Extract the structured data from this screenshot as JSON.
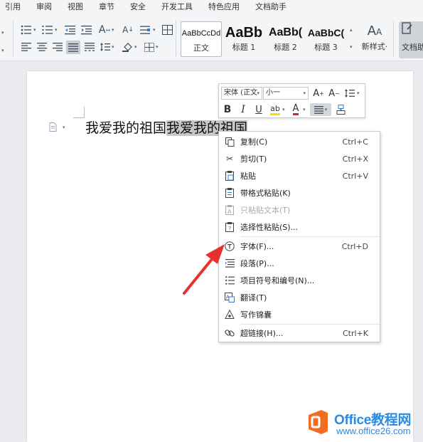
{
  "menubar": {
    "tabs": [
      "引用",
      "审阅",
      "视图",
      "章节",
      "安全",
      "开发工具",
      "特色应用",
      "文档助手"
    ]
  },
  "ribbon": {
    "styles": [
      {
        "sample": "AaBbCcDd",
        "name": "正文"
      },
      {
        "sample": "AaBb",
        "name": "标题 1"
      },
      {
        "sample": "AaBb(",
        "name": "标题 2"
      },
      {
        "sample": "AaBbC(",
        "name": "标题 3"
      }
    ],
    "new_style_label": "新样式·",
    "doc_helper_label": "文档助"
  },
  "document": {
    "text_plain": "我爱我的祖国",
    "text_selected": "我爱我的祖国"
  },
  "mini_toolbar": {
    "font_name": "宋体 (正文",
    "font_size": "小一"
  },
  "context_menu": {
    "items": [
      {
        "label": "复制(C)",
        "shortcut": "Ctrl+C",
        "icon": "copy-icon"
      },
      {
        "label": "剪切(T)",
        "shortcut": "Ctrl+X",
        "icon": "cut-icon"
      },
      {
        "label": "粘贴",
        "shortcut": "Ctrl+V",
        "icon": "paste-icon"
      },
      {
        "label": "带格式粘贴(K)",
        "shortcut": "",
        "icon": "paste-format-icon"
      },
      {
        "label": "只粘贴文本(T)",
        "shortcut": "",
        "icon": "paste-text-icon",
        "disabled": true
      },
      {
        "label": "选择性粘贴(S)...",
        "shortcut": "",
        "icon": "paste-special-icon"
      },
      {
        "label": "字体(F)...",
        "shortcut": "Ctrl+D",
        "icon": "font-icon"
      },
      {
        "label": "段落(P)...",
        "shortcut": "",
        "icon": "paragraph-icon"
      },
      {
        "label": "项目符号和编号(N)...",
        "shortcut": "",
        "icon": "bullets-icon"
      },
      {
        "label": "翻译(T)",
        "shortcut": "",
        "icon": "translate-icon"
      },
      {
        "label": "写作锦囊",
        "shortcut": "",
        "icon": "writing-icon"
      },
      {
        "label": "超链接(H)...",
        "shortcut": "Ctrl+K",
        "icon": "link-icon"
      }
    ]
  },
  "watermark": {
    "title": "Office教程网",
    "url": "www.office26.com"
  },
  "colors": {
    "annotation_arrow": "#e8312c",
    "watermark_blue": "#2b8be0",
    "logo_orange": "#f36c21"
  }
}
